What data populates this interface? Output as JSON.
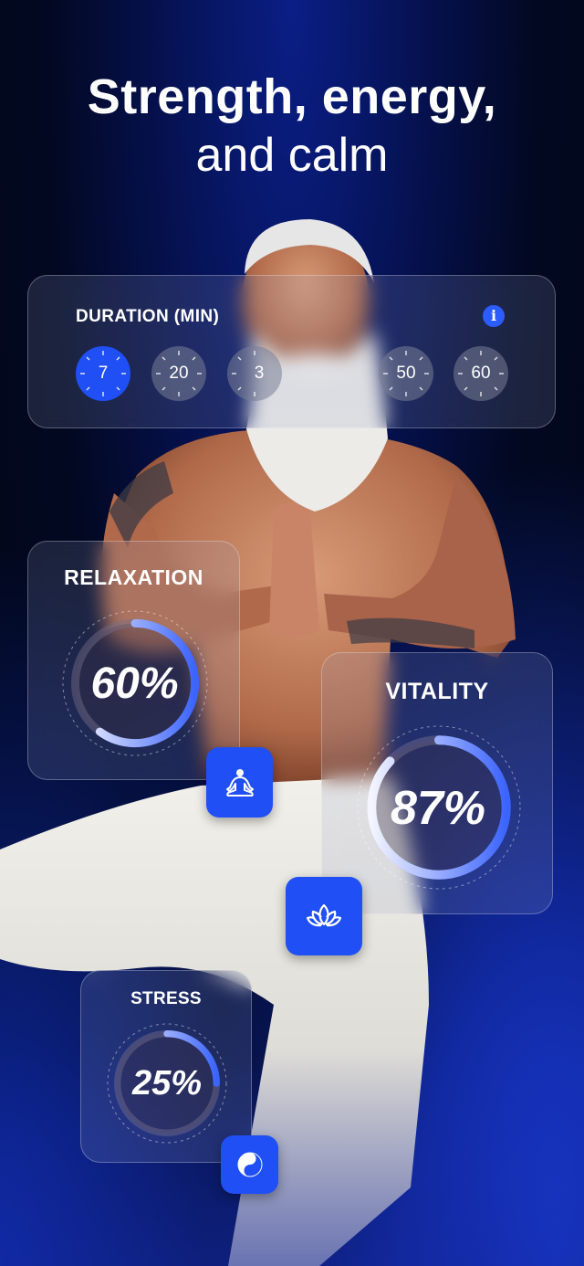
{
  "headline": {
    "line1": "Strength, energy,",
    "line2": "and calm"
  },
  "duration": {
    "label": "DURATION (MIN)",
    "info_icon": "info-icon",
    "options": [
      "7",
      "20",
      "30",
      "50",
      "60"
    ],
    "selected": "7",
    "visible_options": [
      "7",
      "20",
      "3",
      "50",
      "60"
    ]
  },
  "stats": {
    "relaxation": {
      "title": "RELAXATION",
      "value_text": "60%",
      "value": 0.6,
      "icon": "meditation-icon"
    },
    "vitality": {
      "title": "VITALITY",
      "value_text": "87%",
      "value": 0.87,
      "icon": "lotus-icon"
    },
    "stress": {
      "title": "STRESS",
      "value_text": "25%",
      "value": 0.25,
      "icon": "yin-yang-icon"
    }
  },
  "colors": {
    "accent": "#1f4ff5",
    "background": "#05104a"
  }
}
